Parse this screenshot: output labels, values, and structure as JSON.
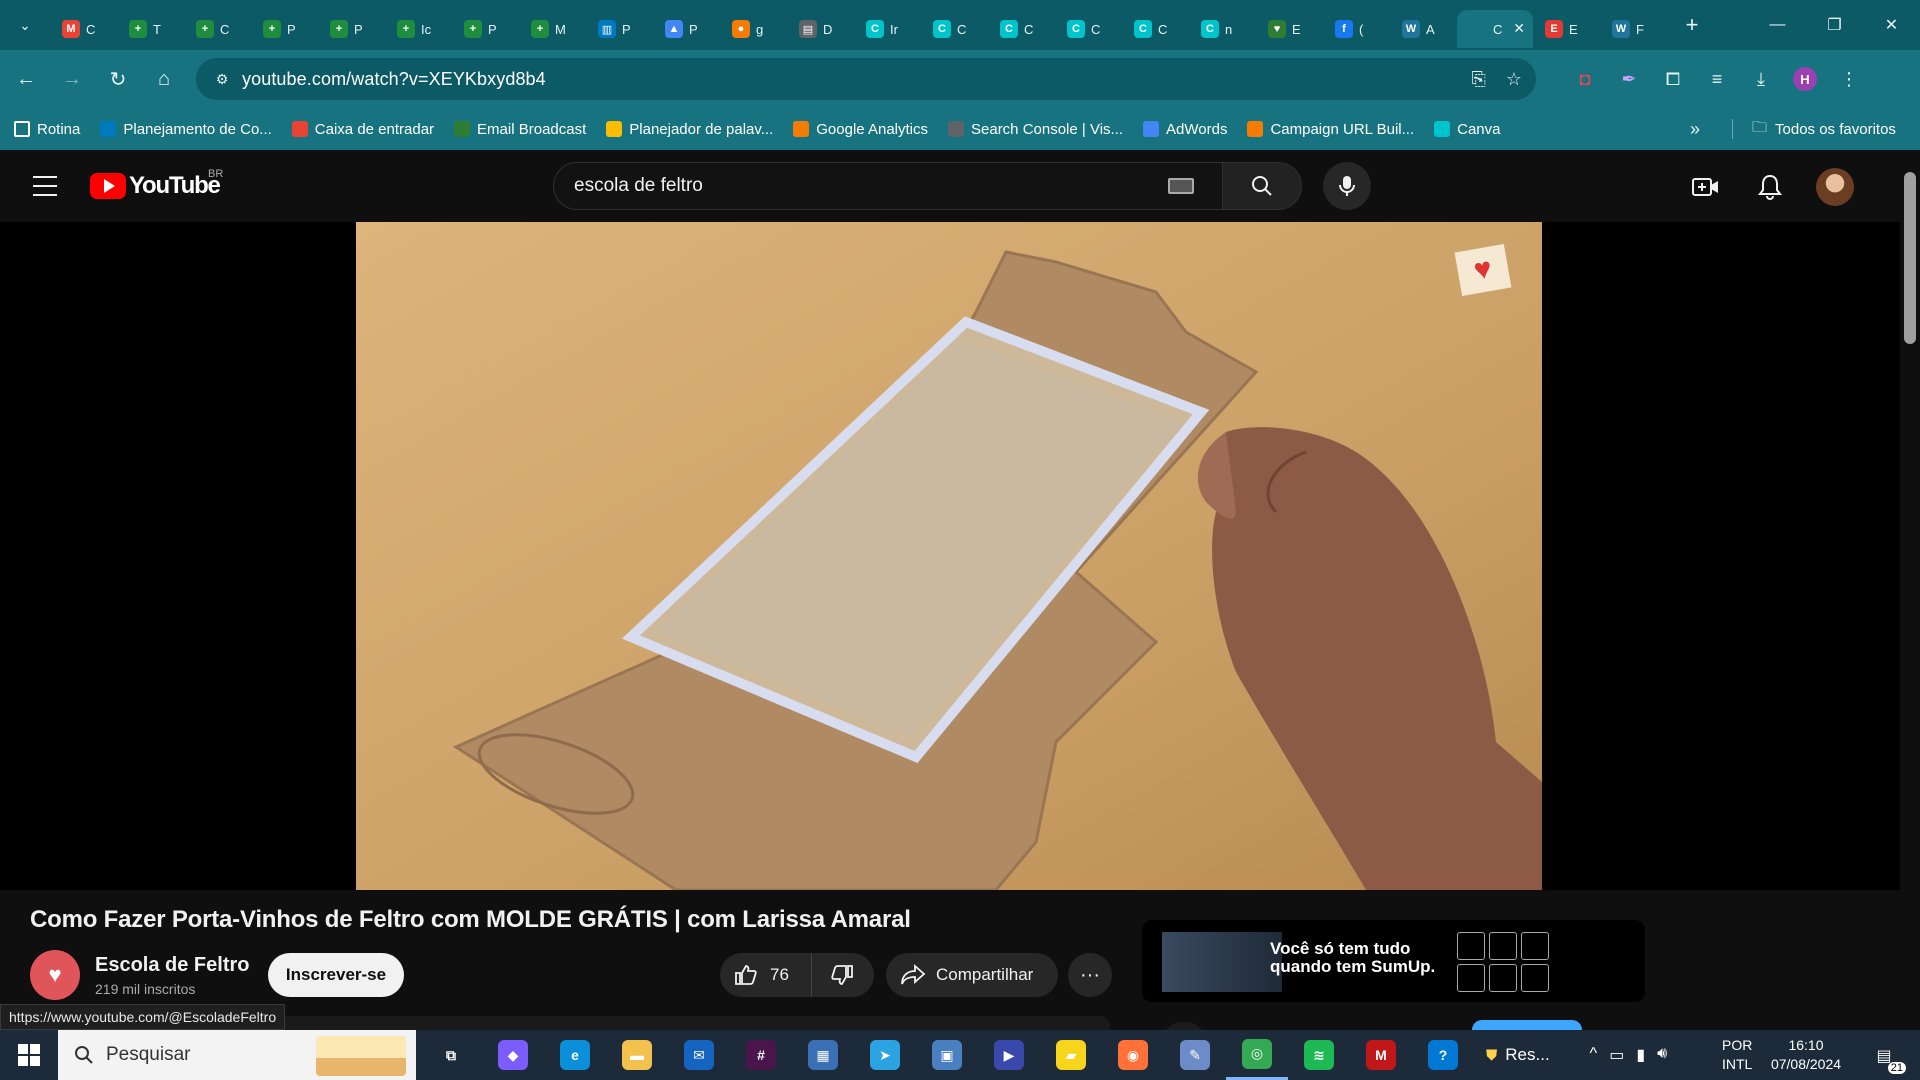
{
  "browser": {
    "tabs": [
      {
        "icon": "gmail-icon",
        "letter": "M",
        "color": "#ea4335",
        "title": "C"
      },
      {
        "icon": "plus-app-icon",
        "letter": "+",
        "color": "#1e8e3e",
        "title": "T"
      },
      {
        "icon": "plus-app-icon",
        "letter": "+",
        "color": "#1e8e3e",
        "title": "C"
      },
      {
        "icon": "plus-app-icon",
        "letter": "+",
        "color": "#1e8e3e",
        "title": "P"
      },
      {
        "icon": "plus-app-icon",
        "letter": "+",
        "color": "#1e8e3e",
        "title": "P"
      },
      {
        "icon": "plus-app-icon",
        "letter": "+",
        "color": "#1e8e3e",
        "title": "Ic"
      },
      {
        "icon": "plus-app-icon",
        "letter": "+",
        "color": "#1e8e3e",
        "title": "P"
      },
      {
        "icon": "plus-app-icon",
        "letter": "+",
        "color": "#1e8e3e",
        "title": "M"
      },
      {
        "icon": "trello-icon",
        "letter": "▥",
        "color": "#0079bf",
        "title": "P"
      },
      {
        "icon": "google-ads-icon",
        "letter": "▲",
        "color": "#4285f4",
        "title": "P"
      },
      {
        "icon": "analytics-icon",
        "letter": "●",
        "color": "#f57c00",
        "title": "g"
      },
      {
        "icon": "store-icon",
        "letter": "▤",
        "color": "#5f6368",
        "title": "D"
      },
      {
        "icon": "canva-icon",
        "letter": "C",
        "color": "#00c4cc",
        "title": "Ir"
      },
      {
        "icon": "canva-icon",
        "letter": "C",
        "color": "#00c4cc",
        "title": "C"
      },
      {
        "icon": "canva-icon",
        "letter": "C",
        "color": "#00c4cc",
        "title": "C"
      },
      {
        "icon": "canva-icon",
        "letter": "C",
        "color": "#00c4cc",
        "title": "C"
      },
      {
        "icon": "canva-icon",
        "letter": "C",
        "color": "#00c4cc",
        "title": "C"
      },
      {
        "icon": "canva-icon",
        "letter": "C",
        "color": "#00c4cc",
        "title": "n"
      },
      {
        "icon": "heart-icon",
        "letter": "♥",
        "color": "#2e7d32",
        "title": "E"
      },
      {
        "icon": "facebook-icon",
        "letter": "f",
        "color": "#1877f2",
        "title": "("
      },
      {
        "icon": "wordpress-icon",
        "letter": "W",
        "color": "#21759b",
        "title": "A"
      },
      {
        "icon": "youtube-icon",
        "letter": "",
        "color": "#17737f",
        "title": "C"
      },
      {
        "icon": "pdf-icon",
        "letter": "E",
        "color": "#e53935",
        "title": "E"
      },
      {
        "icon": "wordpress-icon",
        "letter": "W",
        "color": "#21759b",
        "title": "F"
      }
    ],
    "active_tab_index": 21,
    "url": "youtube.com/watch?v=XEYKbxyd8b4",
    "profile_letter": "H",
    "bookmarks": [
      {
        "icon": "folder-icon",
        "label": "Rotina",
        "color": ""
      },
      {
        "icon": "trello-icon",
        "label": "Planejamento de Co...",
        "color": "#0079bf"
      },
      {
        "icon": "gmail-icon",
        "label": "Caixa de entradar",
        "color": "#ea4335"
      },
      {
        "icon": "k-icon",
        "label": "Email Broadcast",
        "color": "#2e7d32"
      },
      {
        "icon": "google-ads-icon",
        "label": "Planejador de palav...",
        "color": "#fbbc04"
      },
      {
        "icon": "analytics-icon",
        "label": "Google Analytics",
        "color": "#f57c00"
      },
      {
        "icon": "search-console-icon",
        "label": "Search Console | Vis...",
        "color": "#5f6368"
      },
      {
        "icon": "google-ads-icon",
        "label": "AdWords",
        "color": "#4285f4"
      },
      {
        "icon": "campaign-url-icon",
        "label": "Campaign URL Buil...",
        "color": "#f57c00"
      },
      {
        "icon": "canva-icon",
        "label": "Canva",
        "color": "#00c4cc"
      }
    ],
    "all_bookmarks_label": "Todos os favoritos"
  },
  "youtube": {
    "logo_text": "YouTube",
    "country_code": "BR",
    "search_query": "escola de feltro",
    "video_title": "Como Fazer Porta-Vinhos de Feltro com MOLDE GRÁTIS | com Larissa Amaral",
    "channel_name": "Escola de Feltro",
    "subscriber_count": "219 mil inscritos",
    "subscribe_label": "Inscrever-se",
    "like_count": "76",
    "share_label": "Compartilhar",
    "more_label": "···",
    "ad_text": "Você só tem tudo quando tem SumUp."
  },
  "status_bar_url": "https://www.youtube.com/@EscoladeFeltro",
  "taskbar": {
    "search_placeholder": "Pesquisar",
    "apps": [
      {
        "name": "task-view-icon",
        "glyph": "⧉",
        "color": "#1c2a3a"
      },
      {
        "name": "copilot-icon",
        "glyph": "◆",
        "color": "#7b5cff"
      },
      {
        "name": "edge-icon",
        "glyph": "e",
        "color": "#0a8fd8"
      },
      {
        "name": "file-explorer-icon",
        "glyph": "▬",
        "color": "#f2c14e"
      },
      {
        "name": "mail-icon",
        "glyph": "✉",
        "color": "#1565c0"
      },
      {
        "name": "slack-icon",
        "glyph": "#",
        "color": "#4a154b"
      },
      {
        "name": "calculator-icon",
        "glyph": "▦",
        "color": "#3b6fb6"
      },
      {
        "name": "telegram-icon",
        "glyph": "➤",
        "color": "#2aa3e0"
      },
      {
        "name": "photos-icon",
        "glyph": "▣",
        "color": "#4a7fc1"
      },
      {
        "name": "media-icon",
        "glyph": "▶",
        "color": "#3949ab"
      },
      {
        "name": "sticky-notes-icon",
        "glyph": "▰",
        "color": "#f7d51d"
      },
      {
        "name": "firefox-icon",
        "glyph": "◉",
        "color": "#ff7139"
      },
      {
        "name": "paint-icon",
        "glyph": "✎",
        "color": "#6d8cc7"
      },
      {
        "name": "chrome-icon",
        "glyph": "◎",
        "color": "#34a853"
      },
      {
        "name": "spotify-icon",
        "glyph": "≋",
        "color": "#1db954"
      },
      {
        "name": "mcafee-icon",
        "glyph": "M",
        "color": "#c01818"
      },
      {
        "name": "help-icon",
        "glyph": "?",
        "color": "#0078d4"
      }
    ],
    "active_app": "chrome-icon",
    "tray_label": "Res...",
    "lang_line1": "POR",
    "lang_line2": "INTL",
    "time": "16:10",
    "date": "07/08/2024",
    "notification_count": "21"
  }
}
